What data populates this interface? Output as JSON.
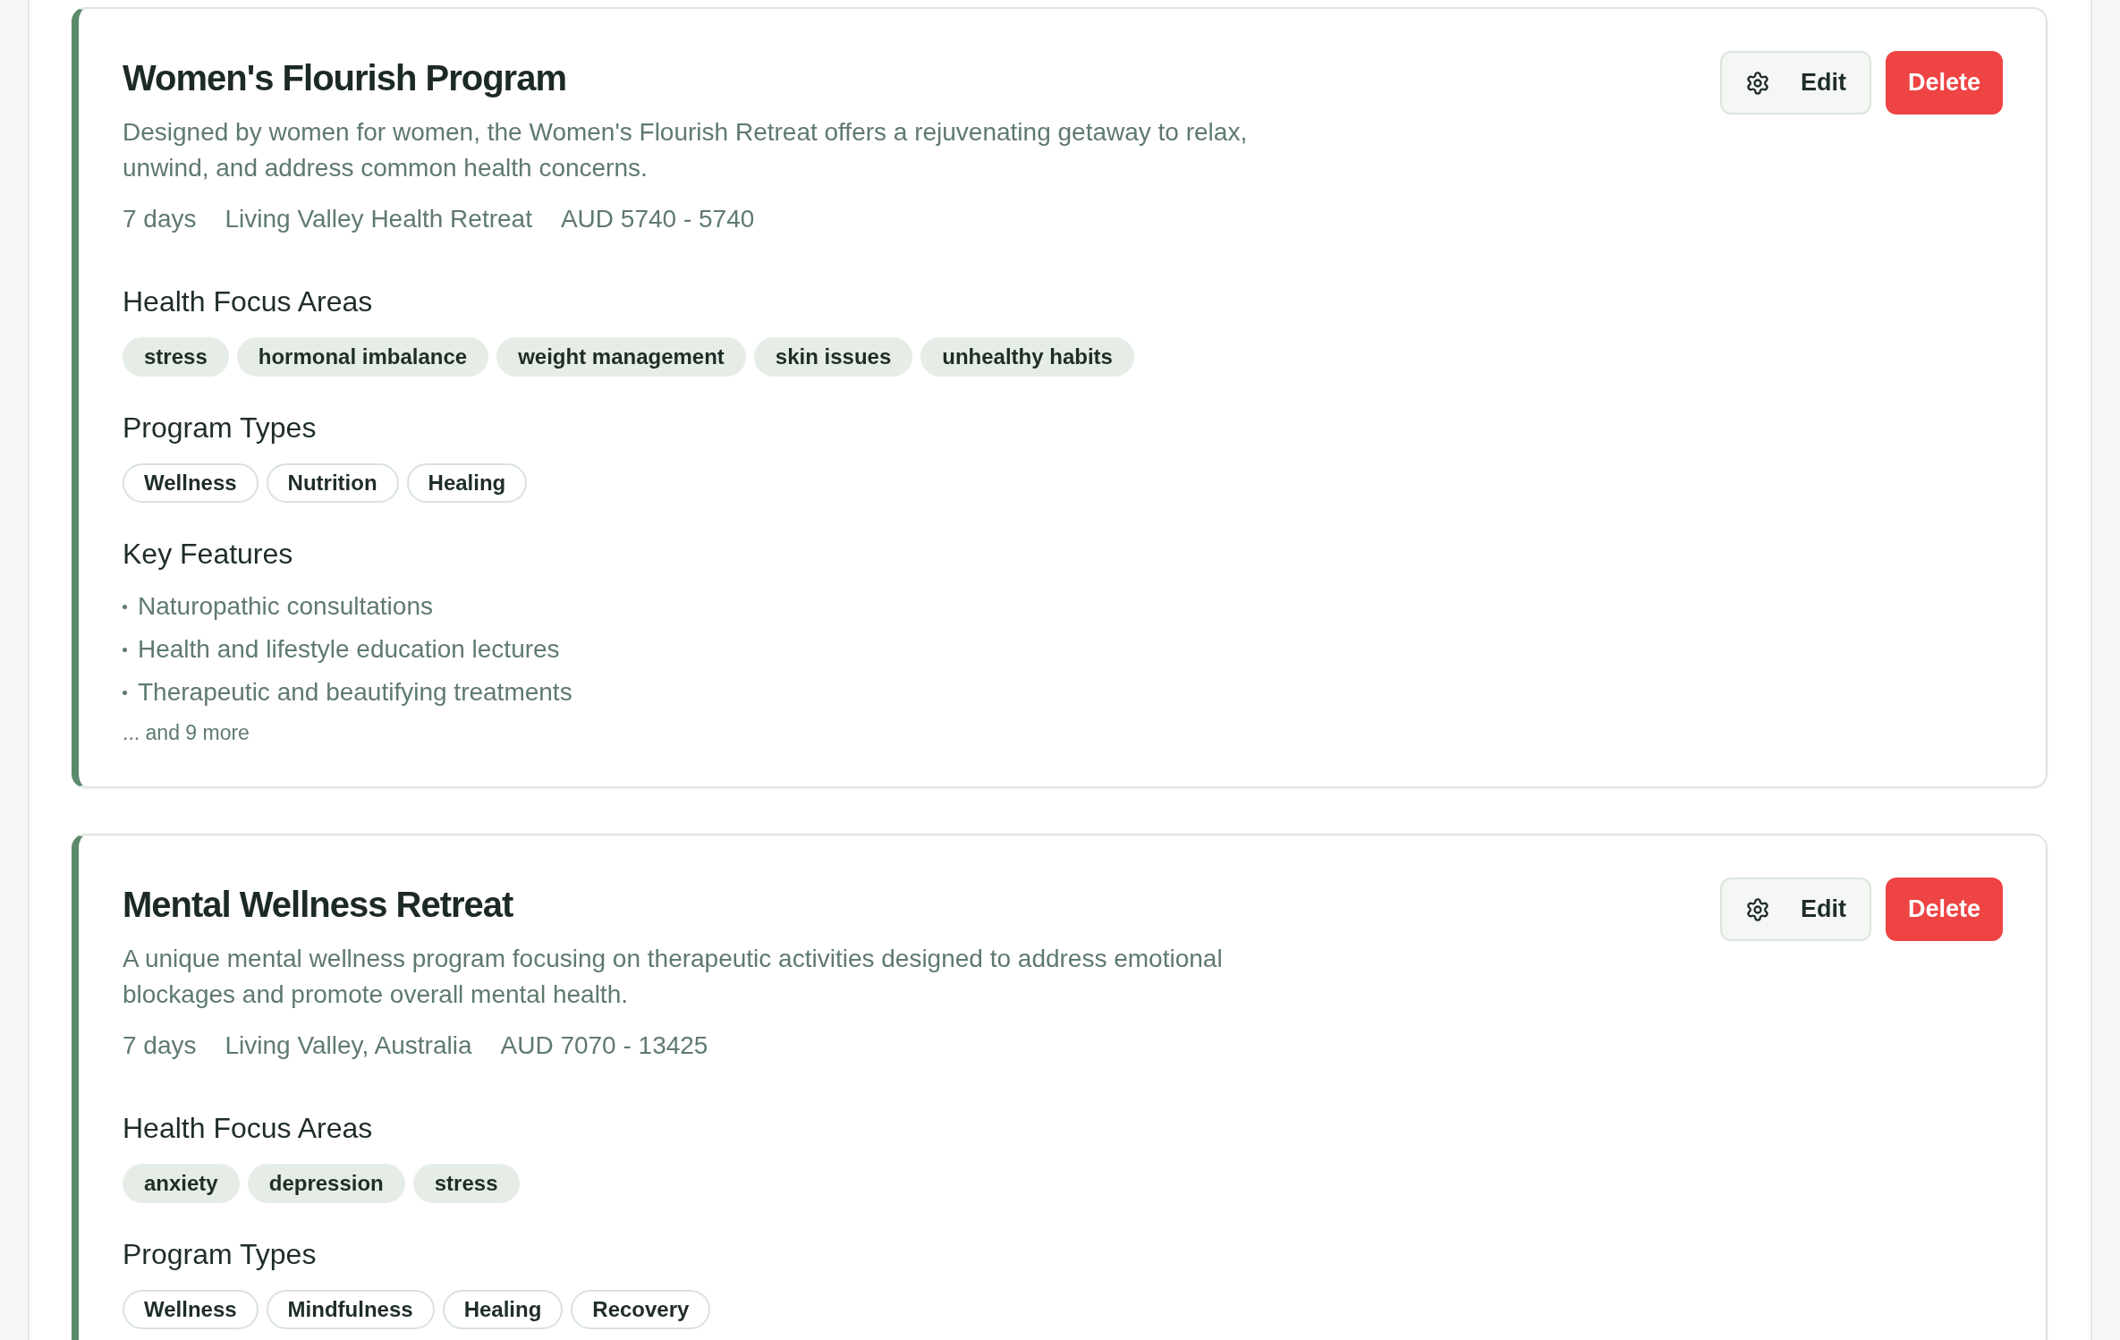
{
  "programs": [
    {
      "title": "Women's Flourish Program",
      "description": "Designed by women for women, the Women's Flourish Retreat offers a rejuvenating getaway to relax, unwind, and address common health concerns.",
      "meta": {
        "duration": "7 days",
        "location": "Living Valley Health Retreat",
        "price": "AUD 5740 - 5740"
      },
      "actions": [
        {
          "kind": "edit",
          "label": "Edit"
        },
        {
          "kind": "delete",
          "label": "Delete"
        }
      ],
      "sections": [
        {
          "kind": "filled_tags",
          "heading": "Health Focus Areas",
          "items": [
            "stress",
            "hormonal imbalance",
            "weight management",
            "skin issues",
            "unhealthy habits"
          ]
        },
        {
          "kind": "outline_tags",
          "heading": "Program Types",
          "items": [
            "Wellness",
            "Nutrition",
            "Healing"
          ]
        },
        {
          "kind": "bullets",
          "heading": "Key Features",
          "items": [
            "Naturopathic consultations",
            "Health and lifestyle education lectures",
            "Therapeutic and beautifying treatments"
          ],
          "more": "... and 9 more"
        }
      ]
    },
    {
      "title": "Mental Wellness Retreat",
      "description": "A unique mental wellness program focusing on therapeutic activities designed to address emotional blockages and promote overall mental health.",
      "meta": {
        "duration": "7 days",
        "location": "Living Valley, Australia",
        "price": "AUD 7070 - 13425"
      },
      "actions": [
        {
          "kind": "edit",
          "label": "Edit"
        },
        {
          "kind": "delete",
          "label": "Delete"
        }
      ],
      "sections": [
        {
          "kind": "filled_tags",
          "heading": "Health Focus Areas",
          "items": [
            "anxiety",
            "depression",
            "stress"
          ]
        },
        {
          "kind": "outline_tags",
          "heading": "Program Types",
          "items": [
            "Wellness",
            "Mindfulness",
            "Healing",
            "Recovery"
          ]
        }
      ]
    }
  ]
}
